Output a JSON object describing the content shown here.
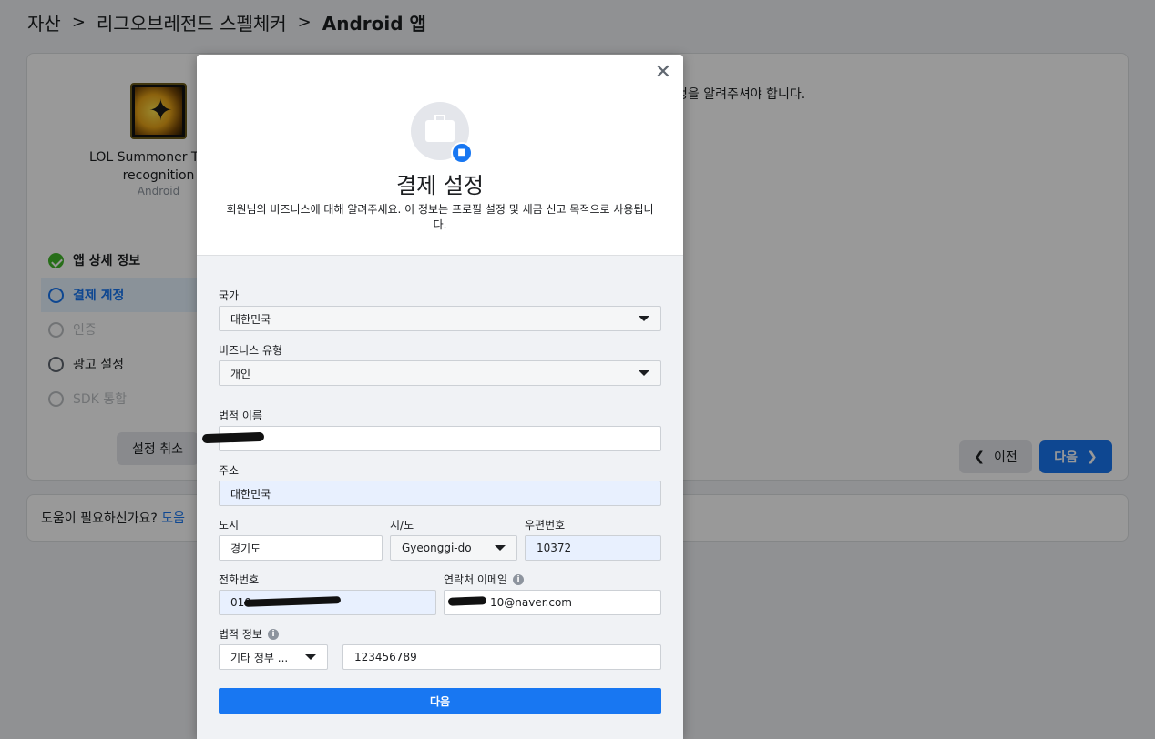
{
  "breadcrumb": [
    "자산",
    "리그오브레전드 스펠체커",
    "Android 앱"
  ],
  "app": {
    "name": "LOL Summoner Timer recognition",
    "platform": "Android"
  },
  "steps": [
    {
      "label": "앱 상세 정보",
      "state": "done"
    },
    {
      "label": "결제 계정",
      "state": "active"
    },
    {
      "label": "인증",
      "state": "disabled"
    },
    {
      "label": "광고 설정",
      "state": "pending"
    },
    {
      "label": "SDK 통합",
      "state": "disabled"
    }
  ],
  "cancel_label": "설정 취소",
  "right_text": "정을 알려주셔야 합니다.",
  "prev_label": "이전",
  "next_label": "다음",
  "help": {
    "text": "도움이 필요하신가요?",
    "link": "도움"
  },
  "modal": {
    "title": "결제 설정",
    "description": "회원님의 비즈니스에 대해 알려주세요. 이 정보는 프로필 설정 및 세금 신고 목적으로 사용됩니다.",
    "country": {
      "label": "국가",
      "value": "대한민국"
    },
    "business_type": {
      "label": "비즈니스 유형",
      "value": "개인"
    },
    "legal_name": {
      "label": "법적 이름",
      "value": ""
    },
    "address": {
      "label": "주소",
      "value": "대한민국"
    },
    "city": {
      "label": "도시",
      "value": "경기도"
    },
    "state": {
      "label": "시/도",
      "value": "Gyeonggi-do"
    },
    "postal": {
      "label": "우편번호",
      "value": "10372"
    },
    "phone": {
      "label": "전화번호",
      "value": "010"
    },
    "email": {
      "label": "연락처 이메일",
      "value": "10@naver.com"
    },
    "legal_info": {
      "label": "법적 정보",
      "type_value": "기타 정부 ...",
      "id_value": "123456789"
    },
    "submit_label": "다음"
  },
  "colors": {
    "accent": "#1877f2",
    "success": "#42b72a"
  }
}
